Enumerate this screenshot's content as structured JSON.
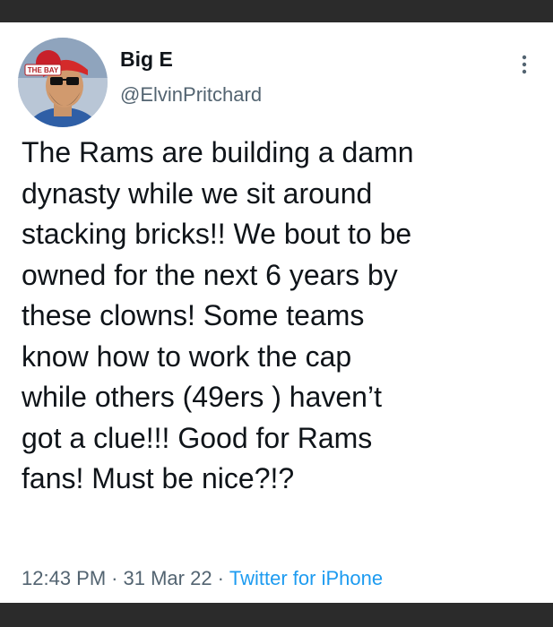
{
  "tweet": {
    "author": {
      "display_name": "Big E",
      "handle": "@ElvinPritchard",
      "avatar_badge_text": "THE BAY"
    },
    "text": "The Rams are building a damn\ndynasty while we sit around\nstacking bricks!! We bout to be\nowned for the next 6 years by\nthese clowns! Some teams\nknow how to work the cap\nwhile others (49ers ) haven’t\ngot a clue!!! Good for Rams\nfans! Must be nice?!?",
    "time": "12:43 PM",
    "date": "31 Mar 22",
    "separator": "·",
    "source": "Twitter for iPhone",
    "more_icon": "more-vertical-icon"
  },
  "colors": {
    "background": "#2b2b2b",
    "card": "#ffffff",
    "text_primary": "#0f1419",
    "text_secondary": "#536471",
    "link": "#1d9bf0"
  }
}
